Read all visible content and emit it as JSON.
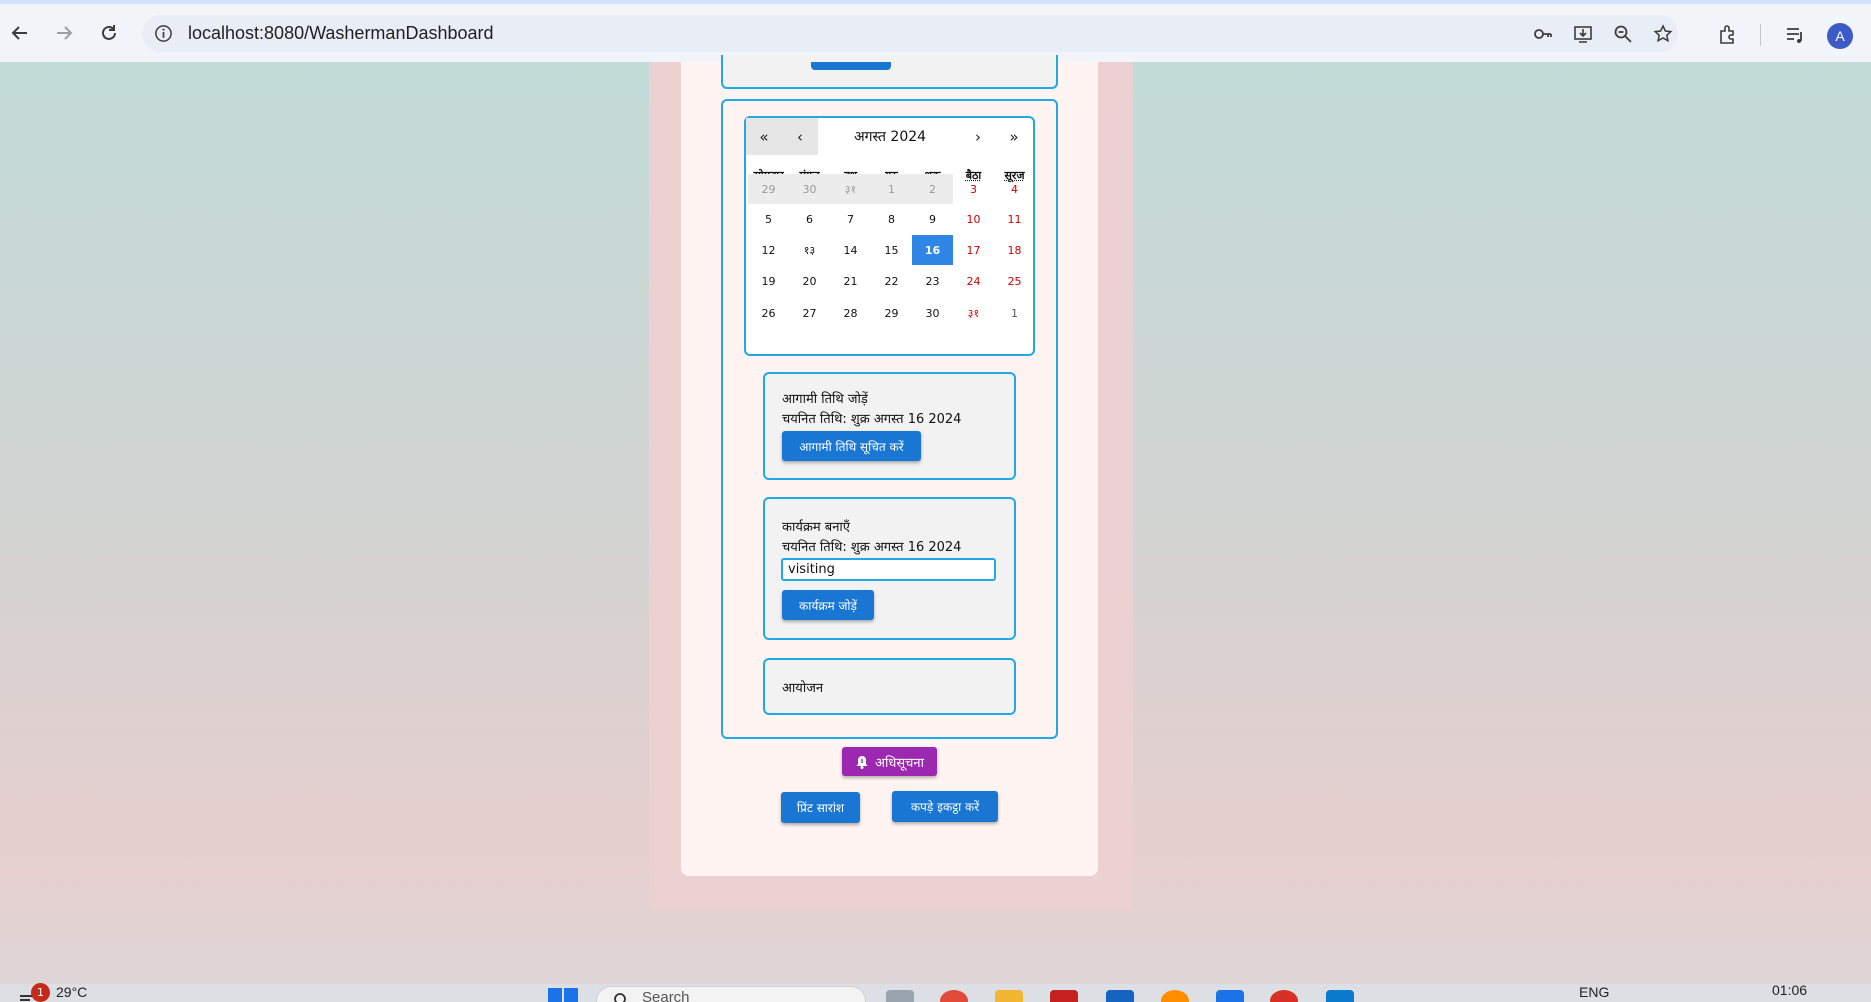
{
  "browser": {
    "url": "localhost:8080/WashermanDashboard",
    "profile_initial": "A"
  },
  "calendar": {
    "month_label": "अगस्त 2024",
    "nav": {
      "prev_year": "«",
      "prev_month": "‹",
      "next_month": "›",
      "next_year": "»"
    },
    "weekdays": [
      "सोमवार",
      "मंगल",
      "बुध",
      "गुरु",
      "शुक्र",
      "बैठा",
      "सूरज"
    ],
    "weeks": [
      [
        "29",
        "30",
        "३१",
        "1",
        "2",
        "3",
        "4"
      ],
      [
        "5",
        "6",
        "7",
        "8",
        "9",
        "10",
        "11"
      ],
      [
        "12",
        "१३",
        "14",
        "15",
        "16",
        "17",
        "18"
      ],
      [
        "19",
        "20",
        "21",
        "22",
        "23",
        "24",
        "25"
      ],
      [
        "26",
        "27",
        "28",
        "29",
        "30",
        "३१",
        "1"
      ]
    ],
    "selected_day": "16",
    "colors": {
      "selected": "#2f86e6",
      "weekend": "#d10000",
      "border": "#21a8e5"
    }
  },
  "upcoming": {
    "title": "आगामी तिथि जोड़ें",
    "selected_date": "चयनित तिथि: शुक्र अगस्त 16 2024",
    "button": "आगामी तिथि सूचित करें"
  },
  "program": {
    "title": "कार्यक्रम बनाएँ",
    "selected_date": "चयनित तिथि: शुक्र अगस्त 16 2024",
    "input_value": "visiting",
    "button": "कार्यक्रम जोड़ें"
  },
  "events": {
    "title": "आयोजन"
  },
  "notify_button": "अधिसूचना",
  "print_button": "प्रिंट सारांश",
  "collect_button": "कपड़े इकट्ठा करें",
  "taskbar": {
    "notification_count": "1",
    "weather": "29°C",
    "search_placeholder": "Search",
    "language": "ENG",
    "time": "01:06"
  }
}
